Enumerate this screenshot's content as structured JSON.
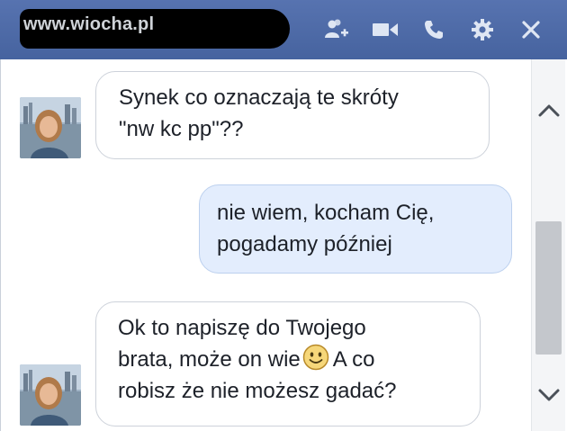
{
  "titlebar": {
    "watermark": "www.wiocha.pl",
    "icons": [
      "add-friend-icon",
      "video-call-icon",
      "voice-call-icon",
      "gear-icon",
      "close-icon"
    ]
  },
  "messages": [
    {
      "sender": "them",
      "lines": [
        "Synek co oznaczają te skróty",
        "\"nw kc pp\"??"
      ]
    },
    {
      "sender": "me",
      "lines": [
        "nie wiem, kocham Cię,",
        "pogadamy później"
      ]
    },
    {
      "sender": "them",
      "lines": [
        "Ok to napiszę do Twojego",
        "brata, może on wie",
        "A co",
        "robisz że nie możesz gadać?"
      ]
    }
  ],
  "emoji": "smiley-face-icon",
  "scrollbar": {
    "up": "chevron-up-icon",
    "down": "chevron-down-icon"
  },
  "colors": {
    "titlebar": "#4d6aa8",
    "bubble_me": "#e3edfd",
    "bubble_them": "#ffffff"
  }
}
